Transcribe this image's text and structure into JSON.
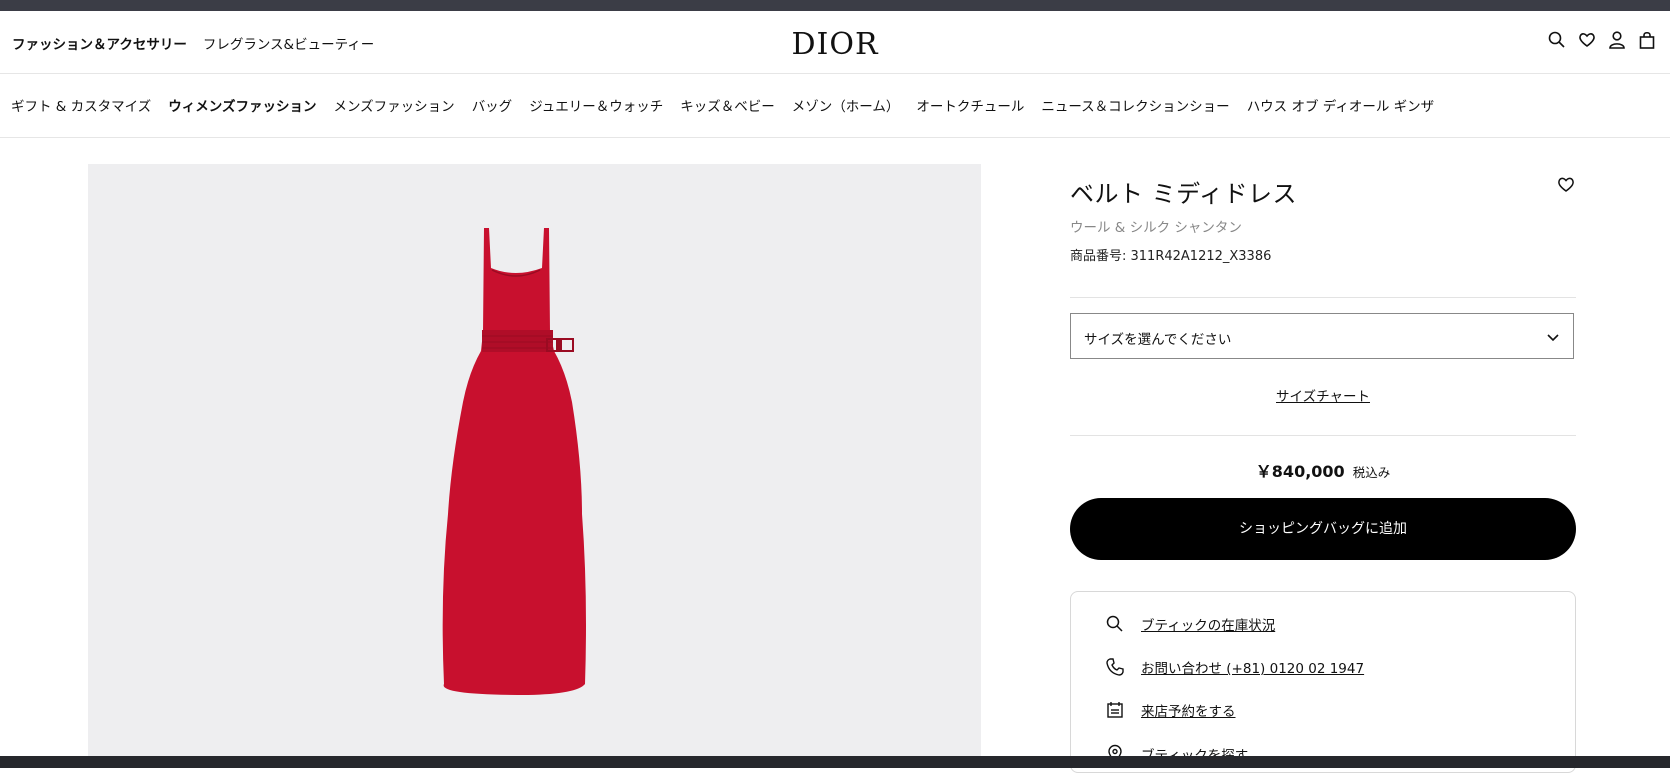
{
  "header": {
    "left_links": [
      "ファッション＆アクセサリー",
      "フレグランス&ビューティー"
    ],
    "logo": "DIOR",
    "icons": [
      "search-icon",
      "heart-icon",
      "user-icon",
      "bag-icon"
    ]
  },
  "nav": {
    "items": [
      "ギフト & カスタマイズ",
      "ウィメンズファッション",
      "メンズファッション",
      "バッグ",
      "ジュエリー＆ウォッチ",
      "キッズ＆ベビー",
      "メゾン（ホーム）",
      "オートクチュール",
      "ニュース＆コレクションショー",
      "ハウス オブ ディオール ギンザ"
    ],
    "active": "ウィメンズファッション"
  },
  "product": {
    "title": "ベルト ミディドレス",
    "subtitle": "ウール & シルク シャンタン",
    "reference": "商品番号: 311R42A1212_X3386",
    "size_select": "サイズを選んでください",
    "size_chart": "サイズチャート",
    "price": "￥840,000",
    "tax_note": "税込み",
    "add_to_bag": "ショッピングバッグに追加",
    "image_colors": {
      "background": "#eeeef0",
      "dress": "#c8102e"
    }
  },
  "services": [
    {
      "icon": "search-icon",
      "label": "ブティックの在庫状況"
    },
    {
      "icon": "phone-icon",
      "label": "お問い合わせ (+81) 0120 02 1947"
    },
    {
      "icon": "calendar-icon",
      "label": "来店予約をする"
    },
    {
      "icon": "location-pin-icon",
      "label": "ブティックを探す"
    }
  ]
}
